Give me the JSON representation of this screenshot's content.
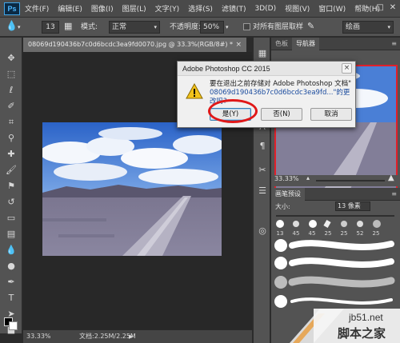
{
  "app": {
    "logo": "Ps",
    "menu": [
      "文件(F)",
      "编辑(E)",
      "图像(I)",
      "图层(L)",
      "文字(Y)",
      "选择(S)",
      "滤镜(T)",
      "3D(D)",
      "视图(V)",
      "窗口(W)",
      "帮助(H)"
    ]
  },
  "options": {
    "brush_size": "13",
    "mode_label": "模式:",
    "mode_value": "正常",
    "opacity_label": "不透明度:",
    "opacity_value": "50%",
    "sample_all_layers": "对所有图层取样",
    "workspace": "绘画"
  },
  "document": {
    "tab_title": "08069d190436b7c0d6bcdc3ea9fd0070.jpg @ 33.3%(RGB/8#) *",
    "tab_close": "×",
    "zoom": "33.33%",
    "doc_info": "文档:2.25M/2.25M"
  },
  "panels": {
    "top_tabs": [
      "色板",
      "导航器"
    ],
    "navigator_zoom": "33.33%",
    "brush_tabs": [
      "画笔预设"
    ],
    "size_label": "大小:",
    "size_value": "13 像素",
    "brush_sizes": [
      "13",
      "45",
      "45",
      "25",
      "25",
      "52",
      "25"
    ]
  },
  "dialog": {
    "title": "Adobe Photoshop CC 2015",
    "close": "×",
    "message_line1": "要在退出之前存储对 Adobe Photoshop 文档\"",
    "message_line2": "08069d190436b7c0d6bcdc3ea9fd...\"的更改吗?",
    "yes": "是(Y)",
    "no": "否(N)",
    "cancel": "取消"
  },
  "watermark": {
    "site": "jb51.net",
    "name": "脚本之家"
  },
  "colors": {
    "accent_red": "#e01818",
    "ps_blue": "#3fa4e8"
  }
}
